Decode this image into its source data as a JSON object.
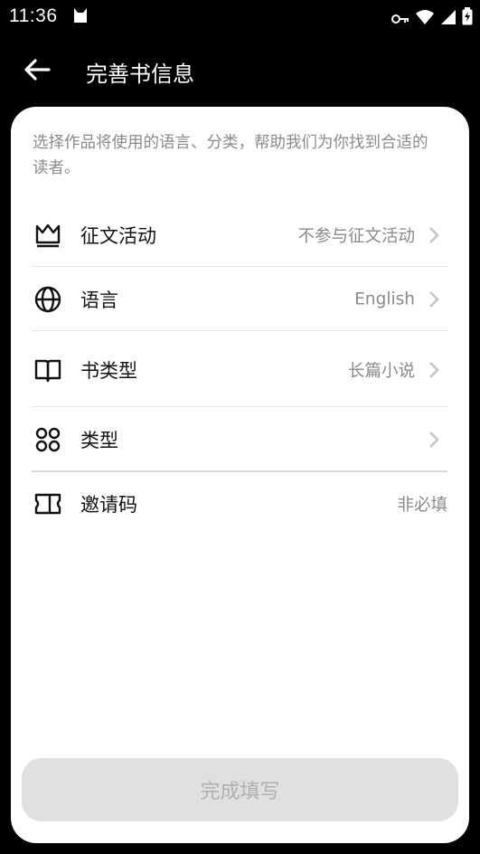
{
  "status_bar": {
    "time": "11:36",
    "icons": [
      "cat-icon",
      "key-icon",
      "wifi-icon",
      "signal-icon",
      "battery-icon"
    ]
  },
  "header": {
    "title": "完善书信息",
    "back_icon": "arrow-left-icon"
  },
  "intro_text": "选择作品将使用的语言、分类，帮助我们为你找到合适的读者。",
  "rows": [
    {
      "label": "征文活动",
      "value": "不参与征文活动",
      "icon": "crown-icon",
      "chevron": true
    },
    {
      "label": "语言",
      "value": "English",
      "icon": "globe-icon",
      "chevron": true
    },
    {
      "label": "书类型",
      "value": "长篇小说",
      "icon": "book-icon",
      "chevron": true
    },
    {
      "label": "类型",
      "value": "",
      "icon": "grid-dots-icon",
      "chevron": true
    },
    {
      "label": "邀请码",
      "value": "非必填",
      "icon": "ticket-icon",
      "chevron": false
    }
  ],
  "submit_label": "完成填写",
  "colors": {
    "background": "#000000",
    "card": "#ffffff",
    "muted_text": "#8a8a8a",
    "button_disabled": "#e0e0e0"
  }
}
